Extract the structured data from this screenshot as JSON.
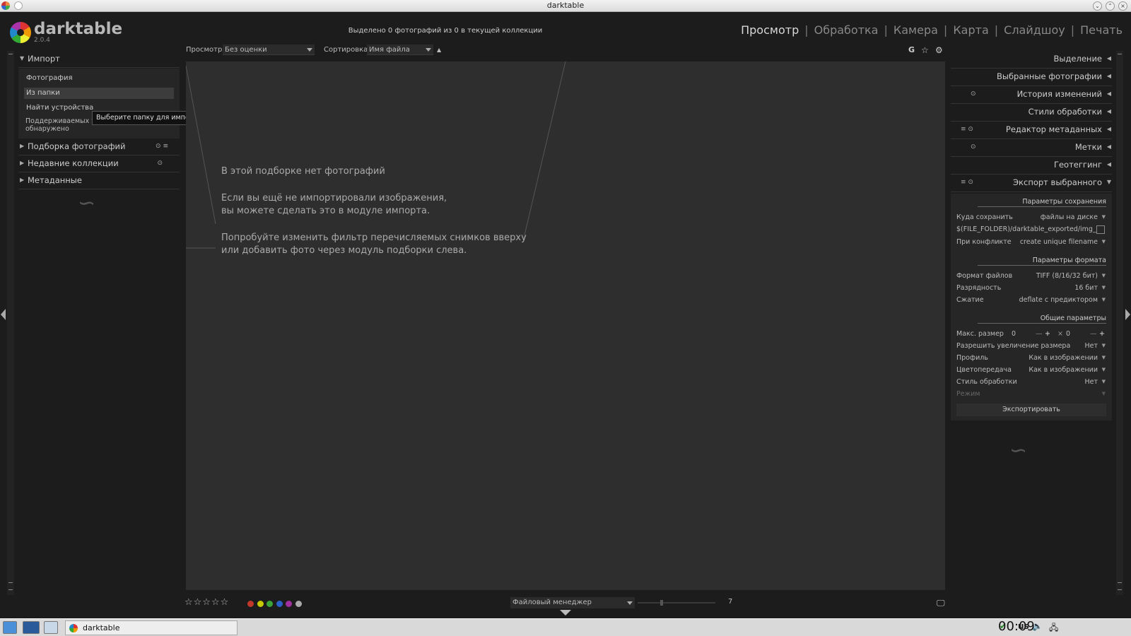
{
  "window": {
    "title": "darktable"
  },
  "app": {
    "name": "darktable",
    "version": "2.0.4"
  },
  "header": {
    "selection_status": "Выделено 0 фотографий из 0 в текущей коллекции",
    "views": [
      "Просмотр",
      "Обработка",
      "Камера",
      "Карта",
      "Слайдшоу",
      "Печать"
    ],
    "active_view": "Просмотр"
  },
  "filterbar": {
    "view_label": "Просмотр",
    "view_value": "Без оценки",
    "sort_label": "Сортировка",
    "sort_value": "Имя файла",
    "sort_dir_icon": "▲",
    "grouping_icon": "G",
    "star_icon": "☆",
    "gear_icon": "⚙"
  },
  "left_panel": {
    "import": {
      "title": "Импорт",
      "buttons": [
        "Фотография",
        "Из папки",
        "Найти устройства"
      ],
      "note": "Поддерживаемых устройств не обнаружено",
      "tooltip": "Выберите папку для импорта как съёмки"
    },
    "modules": [
      {
        "title": "Подборка фотографий",
        "icons": "⊙ ≡"
      },
      {
        "title": "Недавние коллекции",
        "icons": "⊙"
      },
      {
        "title": "Метаданные",
        "icons": ""
      }
    ],
    "swirl": "∽"
  },
  "center": {
    "empty_title": "В этой подборке нет фотографий",
    "line2a": "Если вы ещё не импортировали изображения,",
    "line2b": "вы можете сделать это в модуле импорта.",
    "line3a": "Попробуйте изменить фильтр перечисляемых снимков вверху",
    "line3b": "или добавить фото через модуль подборки слева."
  },
  "right_panel": {
    "modules": [
      {
        "title": "Выделение",
        "icons": ""
      },
      {
        "title": "Выбранные фотографии",
        "icons": ""
      },
      {
        "title": "История изменений",
        "icons": "⊙"
      },
      {
        "title": "Стили обработки",
        "icons": ""
      },
      {
        "title": "Редактор метаданных",
        "icons": "≡ ⊙"
      },
      {
        "title": "Метки",
        "icons": "⊙"
      },
      {
        "title": "Геотеггинг",
        "icons": ""
      },
      {
        "title": "Экспорт выбранного",
        "icons": "≡ ⊙"
      }
    ],
    "export": {
      "storage_section": "Параметры сохранения",
      "target_label": "Куда сохранить",
      "target_value": "файлы на диске",
      "path": "$(FILE_FOLDER)/darktable_exported/img_",
      "conflict_label": "При конфликте",
      "conflict_value": "create unique filename",
      "format_section": "Параметры формата",
      "format_label": "Формат файлов",
      "format_value": "TIFF (8/16/32 бит)",
      "bitdepth_label": "Разрядность",
      "bitdepth_value": "16 бит",
      "compression_label": "Сжатие",
      "compression_value": "deflate с предиктором",
      "global_section": "Общие параметры",
      "maxsize_label": "Макс. размер",
      "maxsize_w": "0",
      "maxsize_h": "0",
      "times": "×",
      "upscale_label": "Разрешить увеличение размера",
      "upscale_value": "Нет",
      "profile_label": "Профиль",
      "profile_value": "Как в изображении",
      "intent_label": "Цветопередача",
      "intent_value": "Как в изображении",
      "style_label": "Стиль обработки",
      "style_value": "Нет",
      "mode_label": "Режим",
      "export_button": "Экспортировать"
    }
  },
  "bottom": {
    "stars": "☆☆☆☆☆",
    "color_labels": [
      "#c0392b",
      "#c8c800",
      "#3aa33a",
      "#2a5fc8",
      "#a030a0",
      "#aaaaaa"
    ],
    "layout_value": "Файловый менеджер",
    "zoom_value": "7",
    "zoom_fraction": 0.3,
    "monitor_icon": "🖵"
  },
  "taskbar": {
    "task_label": "darktable",
    "keyboard": "us",
    "clock": "00:09"
  }
}
